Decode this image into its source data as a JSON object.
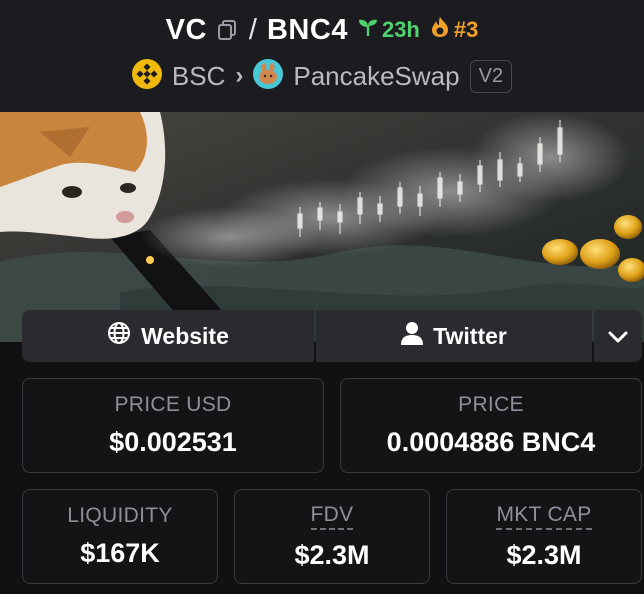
{
  "header": {
    "token_symbol": "VC",
    "separator": "/",
    "quote_symbol": "BNC4",
    "age": "23h",
    "rank": "#3",
    "chain": "BSC",
    "dex": "PancakeSwap",
    "dex_version": "V2"
  },
  "icons": {
    "copy": "copy-icon",
    "age": "seedling-icon",
    "rank": "flame-icon",
    "chain": "bnb-logo-icon",
    "dex": "pancakeswap-logo-icon",
    "website": "globe-icon",
    "twitter": "user-icon",
    "more": "chevron-down-icon"
  },
  "links": {
    "website_label": "Website",
    "twitter_label": "Twitter"
  },
  "stats": {
    "price_usd_label": "PRICE USD",
    "price_usd_value": "$0.002531",
    "price_label": "PRICE",
    "price_value": "0.0004886 BNC4",
    "liquidity_label": "LIQUIDITY",
    "liquidity_value": "$167K",
    "fdv_label": "FDV",
    "fdv_value": "$2.3M",
    "mktcap_label": "MKT CAP",
    "mktcap_value": "$2.3M"
  },
  "colors": {
    "age_green": "#4fd16e",
    "rank_orange": "#f29f2c",
    "bnb_yellow": "#f0b90b"
  }
}
